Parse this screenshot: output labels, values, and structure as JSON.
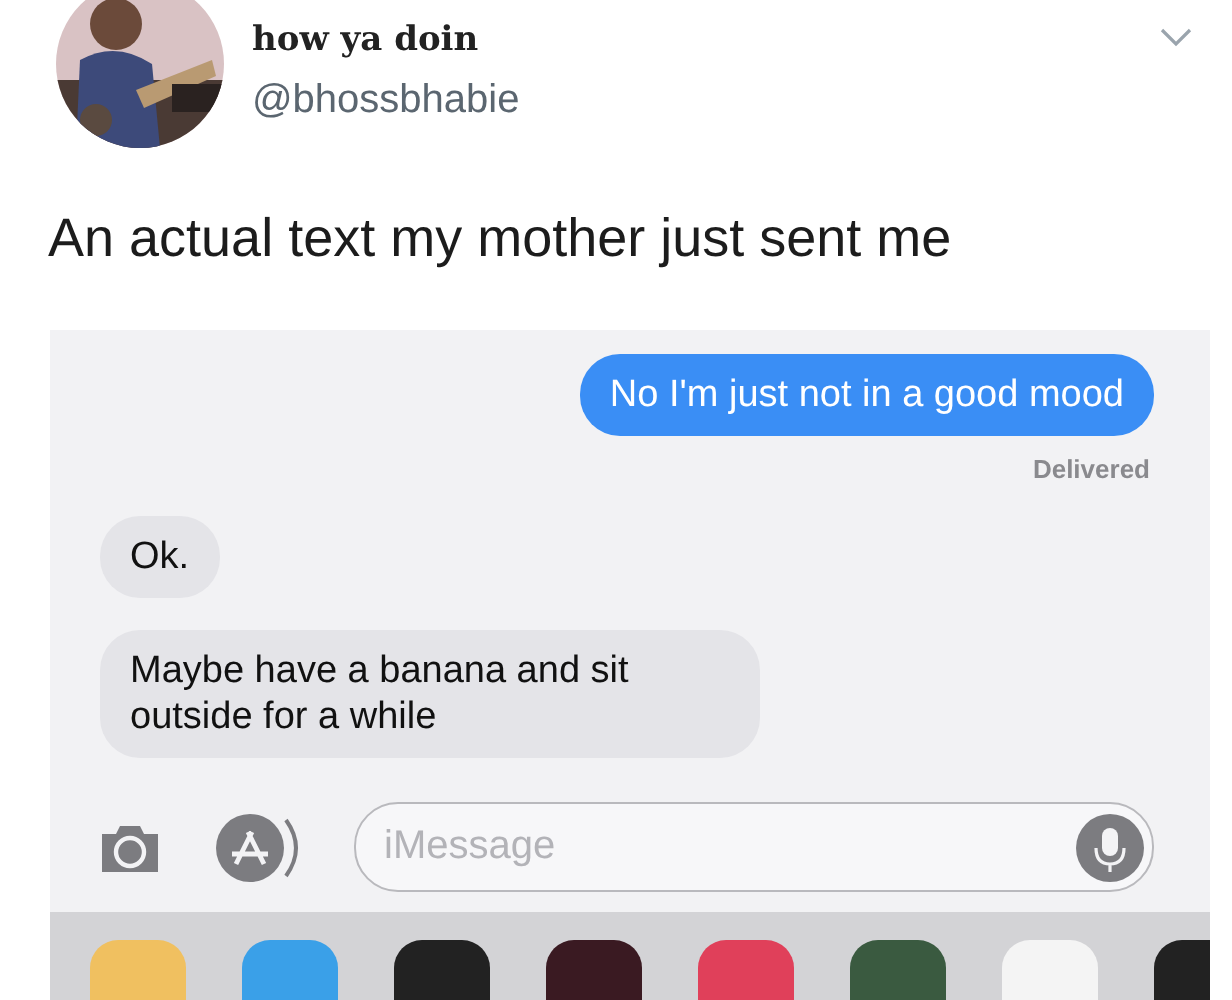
{
  "tweet": {
    "display_name": "how ya doin",
    "handle": "@bhossbhabie",
    "text": "An actual text my mother just sent me"
  },
  "conversation": {
    "messages": [
      {
        "kind": "sent",
        "text": "No I'm just not in a good mood",
        "status": "Delivered"
      },
      {
        "kind": "received",
        "text": "Ok."
      },
      {
        "kind": "received",
        "text": "Maybe have a banana and sit outside for a while"
      }
    ],
    "composer": {
      "placeholder": "iMessage"
    }
  }
}
